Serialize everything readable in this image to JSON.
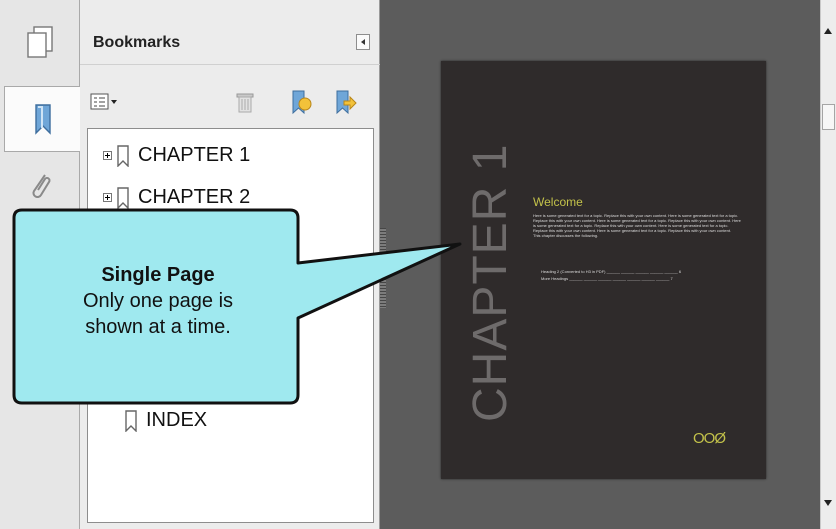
{
  "panel": {
    "title": "Bookmarks",
    "tabs": [
      "pages-icon",
      "bookmark-icon",
      "attachment-icon"
    ],
    "toolbar": [
      "options-menu-icon",
      "delete-bookmark-icon",
      "new-bookmark-icon",
      "expand-bookmark-icon"
    ]
  },
  "tree": {
    "items": [
      {
        "label": "CHAPTER 1",
        "expandable": true
      },
      {
        "label": "CHAPTER 2",
        "expandable": true
      },
      {
        "label": "INDEX",
        "expandable": false
      }
    ]
  },
  "page": {
    "chapter_heading": "CHAPTER 1",
    "welcome": "Welcome",
    "body": "Here is some generated text for a topic. Replace this with your own content. Here is some generated text for a topic. Replace this with your own content. Here is some generated text for a topic. Replace this with your own content. Here is some generated text for a topic. Replace this with your own content. Here is some generated text for a topic. Replace this with your own content. Here is some generated text for a topic. Replace this with your own content.",
    "intro": "This chapter discusses the following.",
    "toc": [
      {
        "label": "Heading 2 (Converted to H3 in PDF)",
        "page": "6"
      },
      {
        "label": "More Headings",
        "page": "7"
      }
    ],
    "ornament": "OOØ"
  },
  "callout": {
    "title": "Single Page",
    "line1": "Only one page is",
    "line2": "shown at a time."
  },
  "colors": {
    "callout_fill": "#9fe9ef",
    "page_bg": "#2f2b2b",
    "accent": "#c3c24a"
  }
}
